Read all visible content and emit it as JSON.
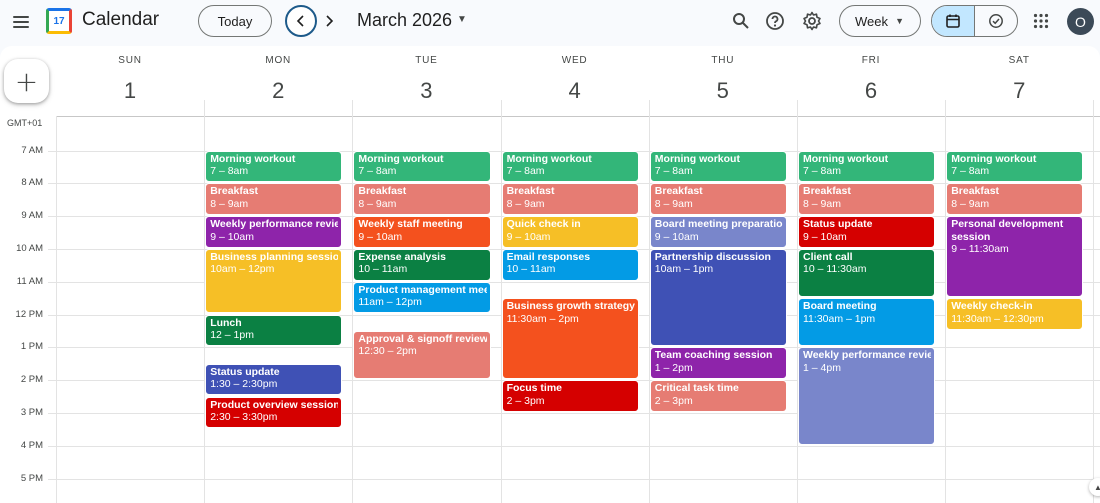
{
  "header": {
    "app_title": "Calendar",
    "logo_text": "17",
    "today_label": "Today",
    "month_title": "March 2026",
    "view_label": "Week",
    "avatar_initial": "O"
  },
  "icons": {
    "menu": "menu-icon",
    "prev": "chevron-left-icon",
    "next": "chevron-right-icon",
    "search": "search-icon",
    "help": "help-icon",
    "settings": "gear-icon",
    "calendar_view": "calendar-icon",
    "tasks_view": "check-circle-icon",
    "apps": "apps-grid-icon",
    "create": "plus-icon"
  },
  "colors": {
    "sage": "#33b679",
    "flamingo": "#e67c73",
    "grape": "#8e24aa",
    "tomato": "#d50000",
    "banana": "#f6bf26",
    "basil": "#0b8043",
    "peacock": "#039be5",
    "tangerine": "#f4511e",
    "lavender": "#7986cb",
    "blueberry": "#3f51b5",
    "selected": "#c2e7ff"
  },
  "timezone": "GMT+01",
  "hours": [
    "7 AM",
    "8 AM",
    "9 AM",
    "10 AM",
    "11 AM",
    "12 PM",
    "1 PM",
    "2 PM",
    "3 PM",
    "4 PM",
    "5 PM"
  ],
  "days": [
    {
      "name": "SUN",
      "num": "1"
    },
    {
      "name": "MON",
      "num": "2"
    },
    {
      "name": "TUE",
      "num": "3"
    },
    {
      "name": "WED",
      "num": "4"
    },
    {
      "name": "THU",
      "num": "5"
    },
    {
      "name": "FRI",
      "num": "6"
    },
    {
      "name": "SAT",
      "num": "7"
    }
  ],
  "events": [
    {
      "day": 1,
      "start": 7,
      "end": 8,
      "title": "Morning workout",
      "time": "7 – 8am",
      "color": "sage"
    },
    {
      "day": 1,
      "start": 8,
      "end": 9,
      "title": "Breakfast",
      "time": "8 – 9am",
      "color": "flamingo"
    },
    {
      "day": 1,
      "start": 9,
      "end": 10,
      "title": "Weekly performance review",
      "time": "9 – 10am",
      "color": "grape"
    },
    {
      "day": 1,
      "start": 10,
      "end": 12,
      "title": "Business planning session",
      "time": "10am – 12pm",
      "color": "banana"
    },
    {
      "day": 1,
      "start": 12,
      "end": 13,
      "title": "Lunch",
      "time": "12 – 1pm",
      "color": "basil"
    },
    {
      "day": 1,
      "start": 13.5,
      "end": 14.5,
      "title": "Status update",
      "time": "1:30 – 2:30pm",
      "color": "blueberry"
    },
    {
      "day": 1,
      "start": 14.5,
      "end": 15.5,
      "title": "Product overview session",
      "time": "2:30 – 3:30pm",
      "color": "tomato"
    },
    {
      "day": 2,
      "start": 7,
      "end": 8,
      "title": "Morning workout",
      "time": "7 – 8am",
      "color": "sage"
    },
    {
      "day": 2,
      "start": 8,
      "end": 9,
      "title": "Breakfast",
      "time": "8 – 9am",
      "color": "flamingo"
    },
    {
      "day": 2,
      "start": 9,
      "end": 10,
      "title": "Weekly staff meeting",
      "time": "9 – 10am",
      "color": "tangerine"
    },
    {
      "day": 2,
      "start": 10,
      "end": 11,
      "title": "Expense analysis",
      "time": "10 – 11am",
      "color": "basil"
    },
    {
      "day": 2,
      "start": 11,
      "end": 12,
      "title": "Product management meeting",
      "time": "11am – 12pm",
      "color": "peacock"
    },
    {
      "day": 2,
      "start": 12.5,
      "end": 14,
      "title": "Approval & signoff review",
      "time": "12:30 – 2pm",
      "color": "flamingo"
    },
    {
      "day": 3,
      "start": 7,
      "end": 8,
      "title": "Morning workout",
      "time": "7 – 8am",
      "color": "sage"
    },
    {
      "day": 3,
      "start": 8,
      "end": 9,
      "title": "Breakfast",
      "time": "8 – 9am",
      "color": "flamingo"
    },
    {
      "day": 3,
      "start": 9,
      "end": 10,
      "title": "Quick check in",
      "time": "9 – 10am",
      "color": "banana"
    },
    {
      "day": 3,
      "start": 10,
      "end": 11,
      "title": "Email responses",
      "time": "10 – 11am",
      "color": "peacock"
    },
    {
      "day": 3,
      "start": 11.5,
      "end": 14,
      "title": "Business growth strategy",
      "time": "11:30am – 2pm",
      "color": "tangerine"
    },
    {
      "day": 3,
      "start": 14,
      "end": 15,
      "title": "Focus time",
      "time": "2 – 3pm",
      "color": "tomato"
    },
    {
      "day": 4,
      "start": 7,
      "end": 8,
      "title": "Morning workout",
      "time": "7 – 8am",
      "color": "sage"
    },
    {
      "day": 4,
      "start": 8,
      "end": 9,
      "title": "Breakfast",
      "time": "8 – 9am",
      "color": "flamingo"
    },
    {
      "day": 4,
      "start": 9,
      "end": 10,
      "title": "Board meeting preparation",
      "time": "9 – 10am",
      "color": "lavender"
    },
    {
      "day": 4,
      "start": 10,
      "end": 13,
      "title": "Partnership discussion",
      "time": "10am – 1pm",
      "color": "blueberry"
    },
    {
      "day": 4,
      "start": 13,
      "end": 14,
      "title": "Team coaching session",
      "time": "1 – 2pm",
      "color": "grape"
    },
    {
      "day": 4,
      "start": 14,
      "end": 15,
      "title": "Critical task time",
      "time": "2 – 3pm",
      "color": "flamingo"
    },
    {
      "day": 5,
      "start": 7,
      "end": 8,
      "title": "Morning workout",
      "time": "7 – 8am",
      "color": "sage"
    },
    {
      "day": 5,
      "start": 8,
      "end": 9,
      "title": "Breakfast",
      "time": "8 – 9am",
      "color": "flamingo"
    },
    {
      "day": 5,
      "start": 9,
      "end": 10,
      "title": "Status update",
      "time": "9 – 10am",
      "color": "tomato"
    },
    {
      "day": 5,
      "start": 10,
      "end": 11.5,
      "title": "Client call",
      "time": "10 – 11:30am",
      "color": "basil"
    },
    {
      "day": 5,
      "start": 11.5,
      "end": 13,
      "title": "Board meeting",
      "time": "11:30am – 1pm",
      "color": "peacock"
    },
    {
      "day": 5,
      "start": 13,
      "end": 16,
      "title": "Weekly performance review",
      "time": "1 – 4pm",
      "color": "lavender"
    },
    {
      "day": 6,
      "start": 7,
      "end": 8,
      "title": "Morning workout",
      "time": "7 – 8am",
      "color": "sage"
    },
    {
      "day": 6,
      "start": 8,
      "end": 9,
      "title": "Breakfast",
      "time": "8 – 9am",
      "color": "flamingo"
    },
    {
      "day": 6,
      "start": 9,
      "end": 11.5,
      "title": "Personal development session",
      "time": "9 – 11:30am",
      "color": "grape",
      "wrap": true
    },
    {
      "day": 6,
      "start": 11.5,
      "end": 12.5,
      "title": "Weekly check-in",
      "time": "11:30am – 12:30pm",
      "color": "banana"
    }
  ]
}
